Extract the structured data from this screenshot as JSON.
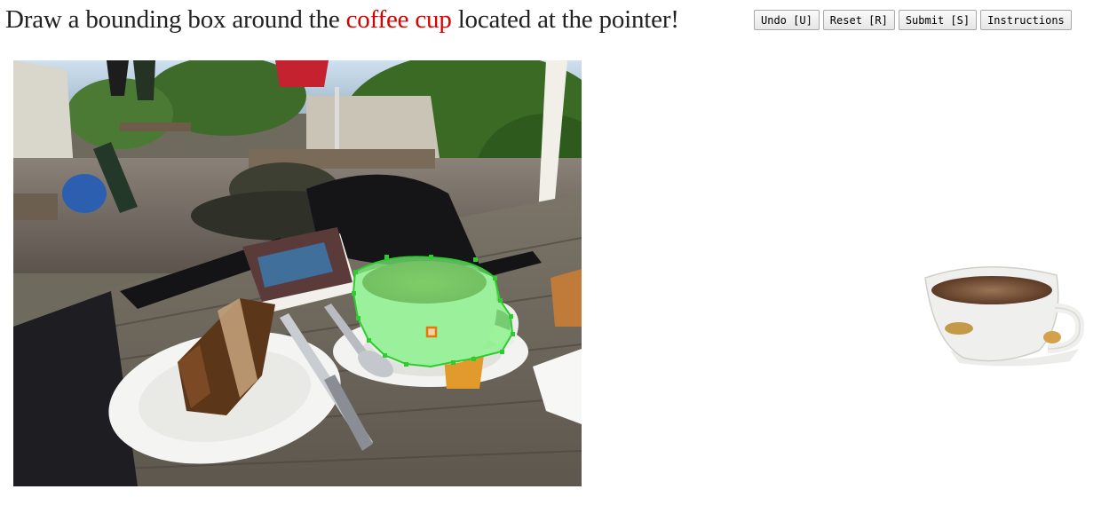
{
  "header": {
    "prompt_before": "Draw a bounding box around the ",
    "target_label": "coffee cup",
    "prompt_after": " located at the pointer!",
    "target_color": "#d80000"
  },
  "toolbar": {
    "undo_label": "Undo [U]",
    "reset_label": "Reset [R]",
    "submit_label": "Submit [S]",
    "instructions_label": "Instructions"
  },
  "annotation": {
    "mask_color": "#7cf27c",
    "pointer_color": "#e07a10",
    "vertex_color": "#2ecc2e"
  }
}
